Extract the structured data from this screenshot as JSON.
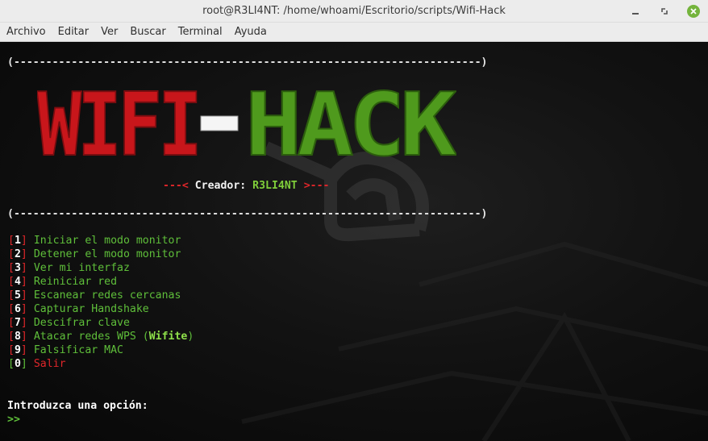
{
  "window": {
    "title": "root@R3LI4NT: /home/whoami/Escritorio/scripts/Wifi-Hack",
    "controls": [
      "minimize-icon",
      "maximize-icon",
      "close-icon"
    ]
  },
  "menubar": {
    "items": [
      "Archivo",
      "Editar",
      "Ver",
      "Buscar",
      "Terminal",
      "Ayuda"
    ]
  },
  "terminal": {
    "border_top": "(-------------------------------------------------------------------------)",
    "border_bottom": "(-------------------------------------------------------------------------)",
    "banner": {
      "left": "WIFI",
      "dash": "-",
      "right": "HACK"
    },
    "creator": {
      "prefix": "---< ",
      "label": "Creador: ",
      "name": "R3LI4NT",
      "suffix": " >---"
    },
    "options": [
      {
        "num": "1",
        "label": "Iniciar el modo monitor"
      },
      {
        "num": "2",
        "label": "Detener el modo monitor"
      },
      {
        "num": "3",
        "label": "Ver mi interfaz"
      },
      {
        "num": "4",
        "label": "Reiniciar red"
      },
      {
        "num": "5",
        "label": "Escanear redes cercanas"
      },
      {
        "num": "6",
        "label": "Capturar Handshake"
      },
      {
        "num": "7",
        "label": "Descifrar clave"
      },
      {
        "num": "8",
        "label": "Atacar redes WPS (",
        "bold": "Wifite",
        "tail": ")"
      },
      {
        "num": "9",
        "label": "Falsificar MAC"
      },
      {
        "num": "0",
        "label": "Salir",
        "color": "red"
      }
    ],
    "prompt": "Introduzca una opción:",
    "input_arrow": ">>"
  },
  "colors": {
    "banner_red": "#c8161b",
    "banner_green": "#4f9a1d",
    "text_green": "#5fbf3a",
    "bracket_red": "#e0262a"
  }
}
